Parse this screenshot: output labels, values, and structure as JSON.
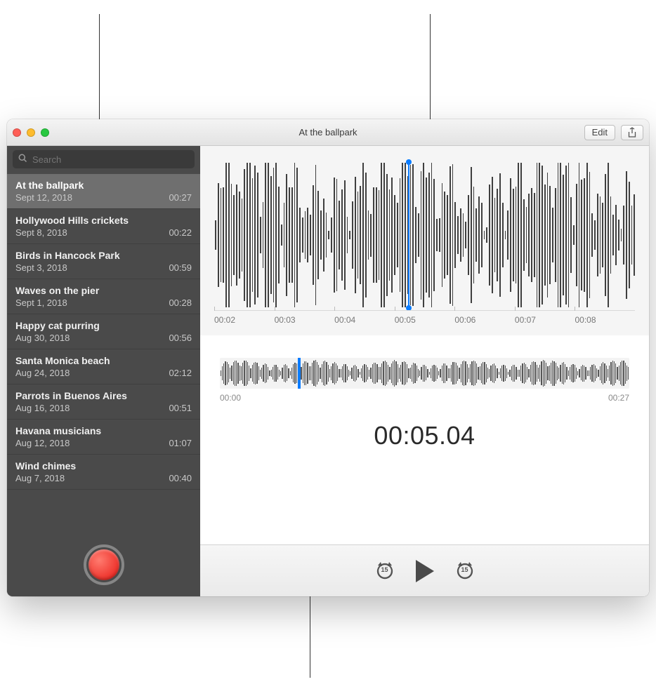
{
  "window_title": "At the ballpark",
  "toolbar": {
    "edit_label": "Edit"
  },
  "search": {
    "placeholder": "Search"
  },
  "recordings": [
    {
      "name": "At the ballpark",
      "date": "Sept 12, 2018",
      "duration": "00:27",
      "selected": true
    },
    {
      "name": "Hollywood Hills crickets",
      "date": "Sept 8, 2018",
      "duration": "00:22",
      "selected": false
    },
    {
      "name": "Birds in Hancock Park",
      "date": "Sept 3, 2018",
      "duration": "00:59",
      "selected": false
    },
    {
      "name": "Waves on the pier",
      "date": "Sept 1, 2018",
      "duration": "00:28",
      "selected": false
    },
    {
      "name": "Happy cat purring",
      "date": "Aug 30, 2018",
      "duration": "00:56",
      "selected": false
    },
    {
      "name": "Santa Monica beach",
      "date": "Aug 24, 2018",
      "duration": "02:12",
      "selected": false
    },
    {
      "name": "Parrots in Buenos Aires",
      "date": "Aug 16, 2018",
      "duration": "00:51",
      "selected": false
    },
    {
      "name": "Havana musicians",
      "date": "Aug 12, 2018",
      "duration": "01:07",
      "selected": false
    },
    {
      "name": "Wind chimes",
      "date": "Aug 7, 2018",
      "duration": "00:40",
      "selected": false
    }
  ],
  "zoom_axis": [
    "00:02",
    "00:03",
    "00:04",
    "00:05",
    "00:06",
    "00:07",
    "00:08"
  ],
  "overview": {
    "start": "00:00",
    "end": "00:27"
  },
  "playhead_time": "00:05.04",
  "playhead_zoom_percent": 46,
  "playhead_overview_percent": 19,
  "skip_seconds": "15",
  "colors": {
    "accent": "#0a7cff",
    "record": "#e7140f"
  }
}
